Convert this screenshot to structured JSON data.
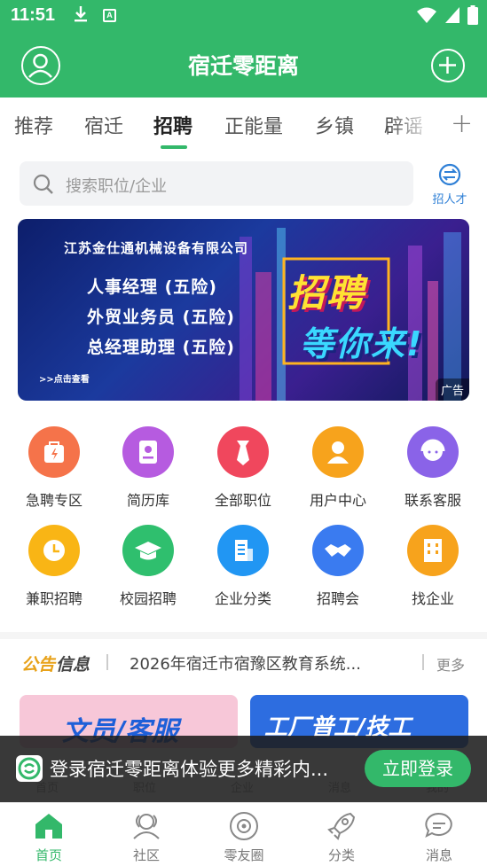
{
  "status_bar": {
    "time": "11:51",
    "app_badge": "A"
  },
  "header": {
    "title": "宿迁零距离"
  },
  "tabs": [
    {
      "label": "推荐"
    },
    {
      "label": "宿迁"
    },
    {
      "label": "招聘"
    },
    {
      "label": "正能量"
    },
    {
      "label": "乡镇"
    },
    {
      "label": "辟谣"
    }
  ],
  "active_tab": "招聘",
  "search": {
    "placeholder": "搜索职位/企业",
    "recruit_label": "招人才"
  },
  "banner": {
    "company": "江苏金仕通机械设备有限公司",
    "jobs": [
      "人事经理 (五险)",
      "外贸业务员 (五险)",
      "总经理助理 (五险)"
    ],
    "slogan_1": "招聘",
    "slogan_2": "等你来!",
    "more": ">>点击查看",
    "ad_label": "广告"
  },
  "grid_row1": [
    {
      "label": "急聘专区",
      "color": "#f5734a",
      "icon": "bag-lightning-icon"
    },
    {
      "label": "简历库",
      "color": "#b65be0",
      "icon": "resume-icon"
    },
    {
      "label": "全部职位",
      "color": "#f0475d",
      "icon": "tie-icon"
    },
    {
      "label": "用户中心",
      "color": "#f7a31c",
      "icon": "user-icon"
    },
    {
      "label": "联系客服",
      "color": "#8a63e8",
      "icon": "service-agent-icon"
    }
  ],
  "grid_row2": [
    {
      "label": "兼职招聘",
      "color": "#f9b515",
      "icon": "clock-icon"
    },
    {
      "label": "校园招聘",
      "color": "#2fbf6e",
      "icon": "graduation-cap-icon"
    },
    {
      "label": "企业分类",
      "color": "#2196f3",
      "icon": "building-doc-icon"
    },
    {
      "label": "招聘会",
      "color": "#3a7bf0",
      "icon": "handshake-icon"
    },
    {
      "label": "找企业",
      "color": "#f7a31c",
      "icon": "office-building-icon"
    }
  ],
  "notice": {
    "title_a": "公告",
    "title_b": "信息",
    "text": "2026年宿迁市宿豫区教育系统...",
    "more": "更多"
  },
  "cards": [
    {
      "text": "文员/客服",
      "color": "#f7c7d8"
    },
    {
      "text": "工厂普工/技工",
      "color": "#2d6de0"
    }
  ],
  "ghost_nav": [
    "首页",
    "职位",
    "企业",
    "消息",
    "我的"
  ],
  "toast": {
    "message": "登录宿迁零距离体验更多精彩内...",
    "button": "立即登录"
  },
  "bottom_nav": [
    {
      "label": "首页",
      "icon": "home-icon",
      "active": true
    },
    {
      "label": "社区",
      "icon": "community-icon",
      "active": false
    },
    {
      "label": "零友圈",
      "icon": "circle-icon",
      "active": false
    },
    {
      "label": "分类",
      "icon": "rocket-icon",
      "active": false
    },
    {
      "label": "消息",
      "icon": "message-icon",
      "active": false
    }
  ],
  "accent_color": "#33b86a"
}
